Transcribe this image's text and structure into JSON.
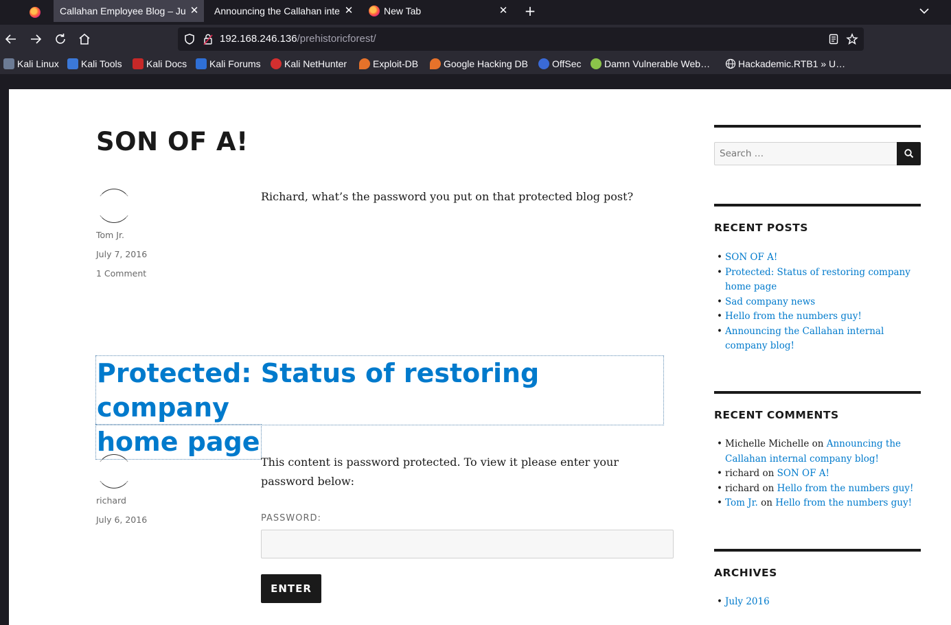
{
  "browser": {
    "tabs": [
      {
        "label": "Callahan Employee Blog – Ju",
        "active": true
      },
      {
        "label": "Announcing the Callahan inte",
        "active": false
      },
      {
        "label": "New Tab",
        "active": false
      }
    ],
    "url_host": "192.168.246.136",
    "url_path": "/prehistoricforest/",
    "bookmarks": [
      {
        "label": "Kali Linux",
        "icon": "kali-dragon-icon",
        "color": "#6c7b95"
      },
      {
        "label": "Kali Tools",
        "icon": "kali-tools-icon",
        "color": "#3b78d8"
      },
      {
        "label": "Kali Docs",
        "icon": "kali-docs-icon",
        "color": "#c62828"
      },
      {
        "label": "Kali Forums",
        "icon": "kali-forums-icon",
        "color": "#2f6fd6"
      },
      {
        "label": "Kali NetHunter",
        "icon": "nethunter-icon",
        "color": "#d32f2f"
      },
      {
        "label": "Exploit-DB",
        "icon": "exploit-db-icon",
        "color": "#e6722a"
      },
      {
        "label": "Google Hacking DB",
        "icon": "ghdb-icon",
        "color": "#e6722a"
      },
      {
        "label": "OffSec",
        "icon": "offsec-icon",
        "color": "#3a6ad6"
      },
      {
        "label": "Damn Vulnerable Web…",
        "icon": "dvwa-icon",
        "color": "#8bc34a"
      },
      {
        "label": "Hackademic.RTB1 » U…",
        "icon": "globe-icon",
        "color": "#fbfbfe"
      }
    ]
  },
  "posts": [
    {
      "title": "SON OF A!",
      "author": "Tom Jr.",
      "date": "July 7, 2016",
      "comments": "1 Comment",
      "content": "Richard, what’s the password you put on that protected blog post?"
    },
    {
      "title_line1": "Protected: Status of restoring company",
      "title_line2": "home page",
      "author": "richard",
      "date": "July 6, 2016",
      "content": "This content is password protected. To view it please enter your password below:",
      "password_label": "PASSWORD:",
      "enter_label": "ENTER"
    }
  ],
  "sidebar": {
    "search_placeholder": "Search …",
    "recent_posts_heading": "RECENT POSTS",
    "recent_posts": [
      "SON OF A!",
      "Protected: Status of restoring company home page",
      "Sad company news",
      "Hello from the numbers guy!",
      "Announcing the Callahan internal company blog!"
    ],
    "recent_comments_heading": "RECENT COMMENTS",
    "recent_comments": [
      {
        "author": "Michelle Michelle",
        "author_link": false,
        "on": "on",
        "post": "Announcing the Callahan internal company blog!"
      },
      {
        "author": "richard",
        "author_link": false,
        "on": "on",
        "post": "SON OF A!"
      },
      {
        "author": "richard",
        "author_link": false,
        "on": "on",
        "post": "Hello from the numbers guy!"
      },
      {
        "author": "Tom Jr.",
        "author_link": true,
        "on": "on",
        "post": "Hello from the numbers guy!"
      }
    ],
    "archives_heading": "ARCHIVES",
    "archives": [
      "July 2016"
    ]
  },
  "colors": {
    "link": "#007acc",
    "text": "#1a1a1a",
    "meta": "#686868"
  }
}
